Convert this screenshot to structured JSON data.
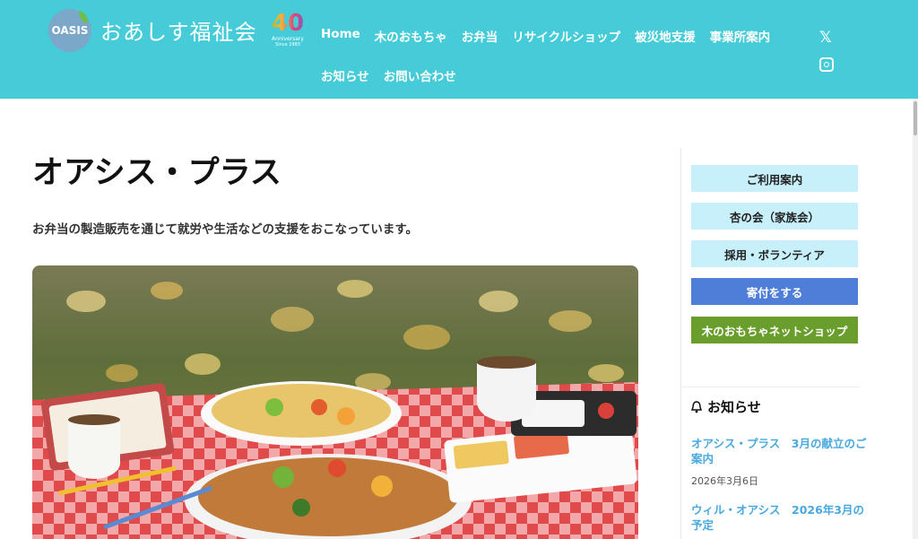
{
  "header": {
    "logo_text": "OASIS",
    "site_title": "おあしす福祉会",
    "anniversary": {
      "number": "40",
      "label": "Anniversary",
      "since": "Since 1983"
    },
    "nav": [
      {
        "label": "Home"
      },
      {
        "label": "木のおもちゃ"
      },
      {
        "label": "お弁当"
      },
      {
        "label": "リサイクルショップ"
      },
      {
        "label": "被災地支援"
      },
      {
        "label": "事業所案内"
      },
      {
        "label": "お知らせ"
      },
      {
        "label": "お問い合わせ"
      }
    ],
    "social": {
      "x_icon": "x-icon",
      "instagram_icon": "instagram-icon"
    },
    "bg_color": "#45ccd8"
  },
  "main": {
    "title": "オアシス・プラス",
    "lead": "お弁当の製造販売を通じて就労や生活などの支援をおこなっています。",
    "photo_alt": "bento-photo"
  },
  "sidebar": {
    "buttons": [
      {
        "label": "ご利用案内",
        "style": "light"
      },
      {
        "label": "杏の会（家族会）",
        "style": "light"
      },
      {
        "label": "採用・ボランティア",
        "style": "light"
      },
      {
        "label": "寄付をする",
        "style": "blue"
      },
      {
        "label": "木のおもちゃネットショップ",
        "style": "green"
      }
    ],
    "news": {
      "heading": "お知らせ",
      "items": [
        {
          "title": "オアシス・プラス　3月の献立のご案内",
          "date": "2026年3月6日"
        },
        {
          "title": "ウィル・オアシス　2026年3月の予定",
          "date": ""
        }
      ]
    }
  }
}
